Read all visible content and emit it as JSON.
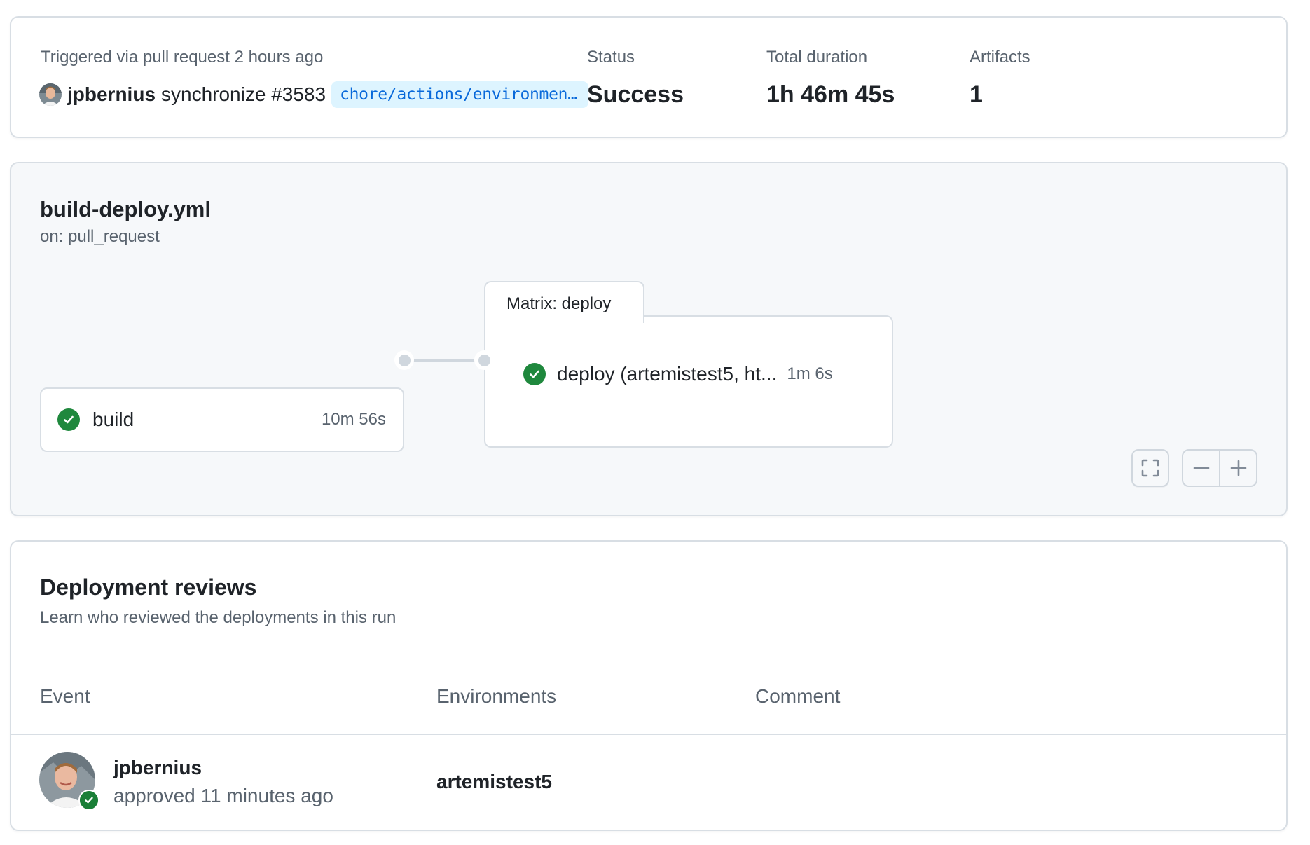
{
  "summary": {
    "trigger_label": "Triggered via pull request 2 hours ago",
    "actor": "jpbernius",
    "event": "synchronize #3583",
    "branch": "chore/actions/environmen…",
    "stats": [
      {
        "label": "Status",
        "value": "Success"
      },
      {
        "label": "Total duration",
        "value": "1h 46m 45s"
      },
      {
        "label": "Artifacts",
        "value": "1"
      }
    ]
  },
  "workflow": {
    "file": "build-deploy.yml",
    "trigger": "on: pull_request",
    "jobs": [
      {
        "name": "build",
        "duration": "10m 56s",
        "status": "success"
      }
    ],
    "matrix": {
      "label": "Matrix: deploy",
      "jobs": [
        {
          "name": "deploy (artemistest5, ht...",
          "duration": "1m 6s",
          "status": "success"
        }
      ]
    },
    "controls": {
      "fullscreen_icon": "fullscreen-icon",
      "zoom_out_icon": "minus-icon",
      "zoom_in_icon": "plus-icon"
    }
  },
  "reviews": {
    "title": "Deployment reviews",
    "subtitle": "Learn who reviewed the deployments in this run",
    "columns": [
      "Event",
      "Environments",
      "Comment"
    ],
    "rows": [
      {
        "user": "jpbernius",
        "action": "approved 11 minutes ago",
        "environment": "artemistest5",
        "comment": ""
      }
    ]
  },
  "colors": {
    "success": "#1f883d",
    "link": "#0969da",
    "branch_bg": "#ddf4ff",
    "muted_text": "#59636e",
    "border": "#d8dee4"
  }
}
